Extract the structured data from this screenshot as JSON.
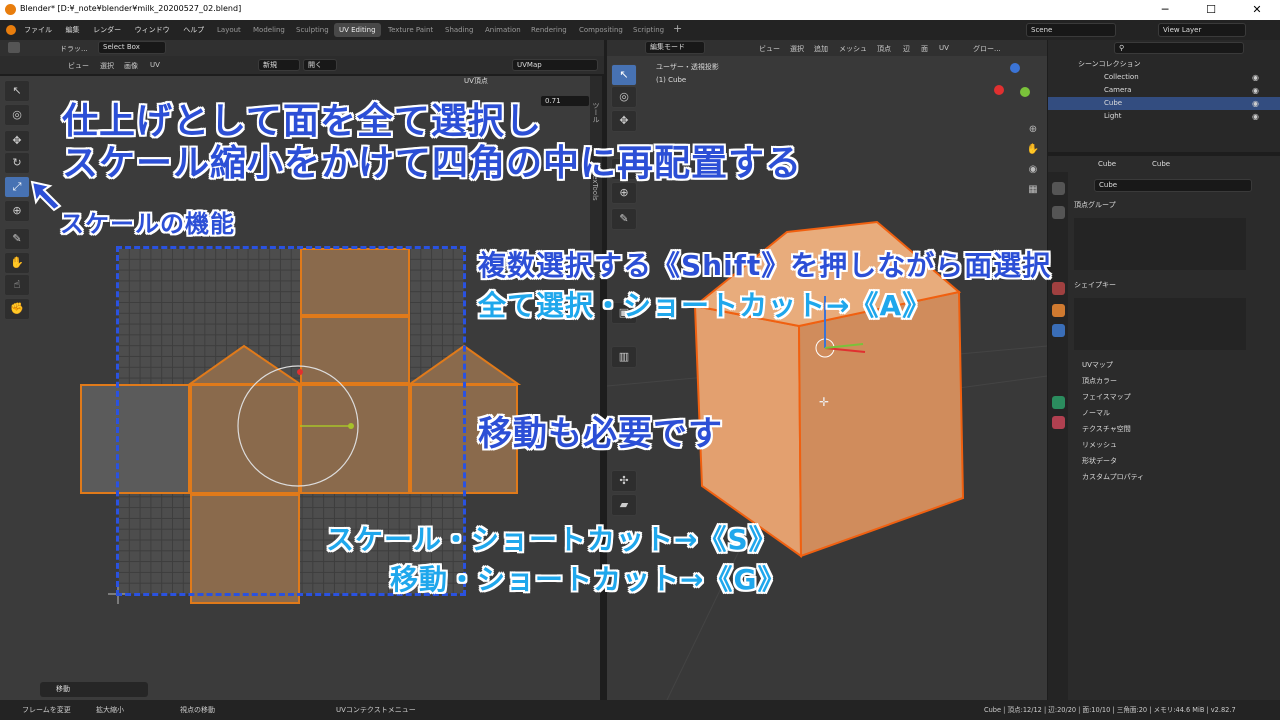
{
  "window": {
    "title": "Blender* [D:¥_note¥blender¥milk_20200527_02.blend]",
    "controls": [
      "─",
      "☐",
      "✕"
    ]
  },
  "menu": [
    "ファイル",
    "編集",
    "レンダー",
    "ウィンドウ",
    "ヘルプ"
  ],
  "workspaces": [
    "Layout",
    "Modeling",
    "Sculpting",
    "UV Editing",
    "Texture Paint",
    "Shading",
    "Animation",
    "Rendering",
    "Compositing",
    "Scripting"
  ],
  "active_workspace": "UV Editing",
  "scene": "Scene",
  "view_layer": "View Layer",
  "uv_header": {
    "drag": "ドラッ...",
    "select_box": "Select Box",
    "menus": [
      "ビュー",
      "選択",
      "画像",
      "UV"
    ],
    "new": "新規",
    "open": "開く",
    "uvmap": "UVMap",
    "uv_vertex": "UV頂点",
    "side_tabs": [
      "ツール",
      "TexTools"
    ],
    "value": "0.71"
  },
  "v3d_header": {
    "mode": "編集モード",
    "menus": [
      "ビュー",
      "選択",
      "追加",
      "メッシュ",
      "頂点",
      "辺",
      "面",
      "UV"
    ],
    "transform": "グロー...",
    "view_name": "ユーザー・透視投影",
    "object": "(1) Cube"
  },
  "outliner": {
    "scene_collection": "シーンコレクション",
    "items": [
      "Collection",
      "Camera",
      "Cube",
      "Light"
    ]
  },
  "props": {
    "object": "Cube",
    "mesh": "Cube",
    "data_name": "Cube",
    "vertex_groups": "頂点グループ",
    "shape_keys": "シェイプキー",
    "sections": [
      "UVマップ",
      "頂点カラー",
      "フェイスマップ",
      "ノーマル",
      "テクスチャ空間",
      "リメッシュ",
      "形状データ",
      "カスタムプロパティ"
    ]
  },
  "operator_panel": "移動",
  "annotations": {
    "line1": "仕上げとして面を全て選択し",
    "line2": "スケール縮小をかけて四角の中に再配置する",
    "scale_func": "スケールの機能",
    "multi": "複数選択する《Shift》を押しながら面選択",
    "all": "全て選択・ショートカット→《A》",
    "move_needed": "移動も必要です",
    "scale_sc": "スケール・ショートカット→《S》",
    "move_sc": "移動・ショートカット→《G》"
  },
  "status": {
    "left": [
      "フレームを変更",
      "拡大縮小",
      "視点の移動",
      "UVコンテクストメニュー"
    ],
    "right": "Cube | 頂点:12/12 | 辺:20/20 | 面:10/10 | 三角面:20 | メモリ:44.6 MiB | v2.82.7"
  },
  "colors": {
    "accent": "#4772b3",
    "annotation_blue": "#2c4fd6",
    "annotation_cyan": "#1fa7ec",
    "selection_orange": "#e07a1a"
  }
}
